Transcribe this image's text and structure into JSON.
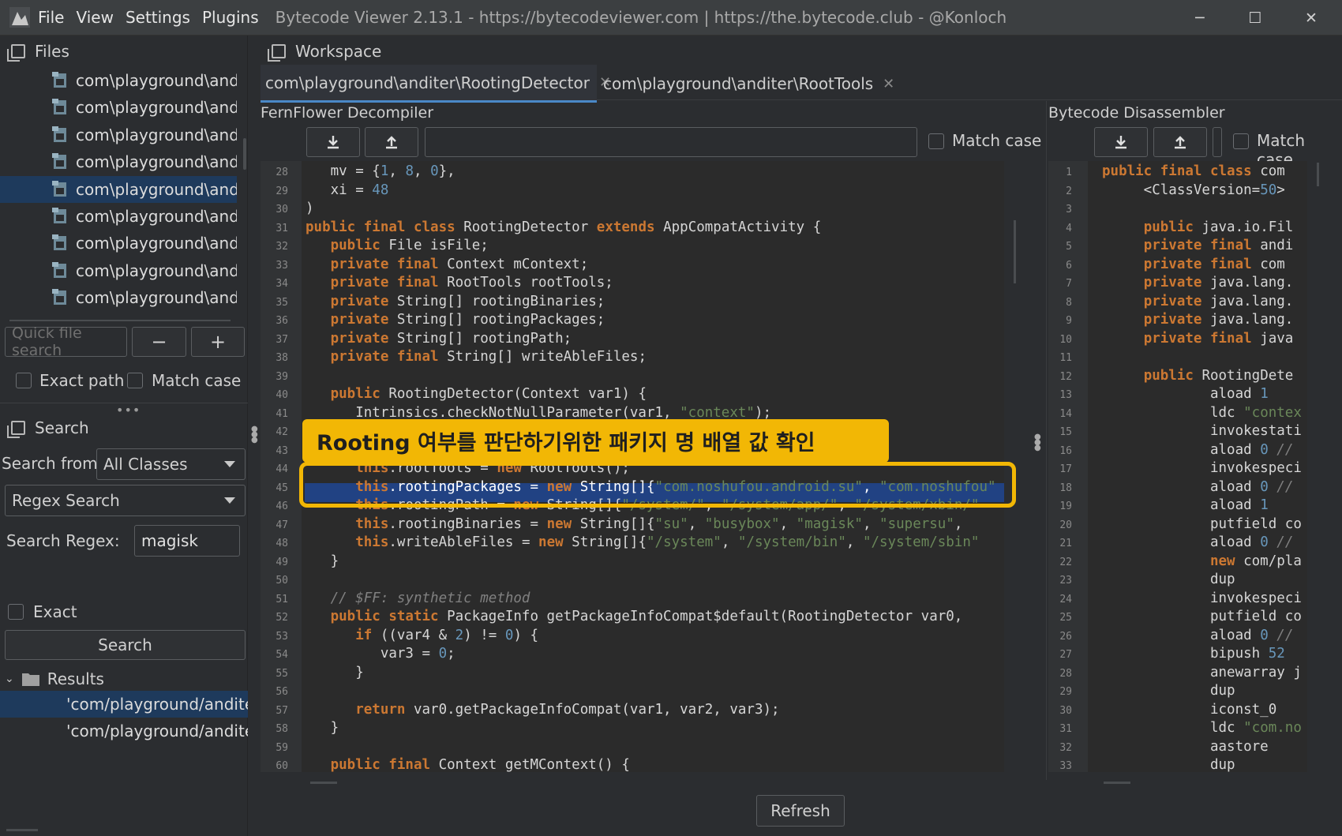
{
  "title_bar": {
    "menu": [
      "File",
      "View",
      "Settings",
      "Plugins"
    ],
    "title": "Bytecode Viewer 2.13.1 - https://bytecodeviewer.com | https://the.bytecode.club - @Konloch",
    "minimize": "─",
    "maximize": "☐",
    "close": "✕"
  },
  "files_panel": {
    "header": "Files",
    "items": [
      "com\\playground\\andi",
      "com\\playground\\andi",
      "com\\playground\\andi",
      "com\\playground\\andi",
      "com\\playground\\andi",
      "com\\playground\\andi",
      "com\\playground\\andi",
      "com\\playground\\andi",
      "com\\playground\\andi"
    ],
    "selected_index": 4,
    "quick_search_placeholder": "Quick file search",
    "minus": "−",
    "plus": "+",
    "exact_path": "Exact path",
    "match_case": "Match case"
  },
  "search_panel": {
    "header": "Search",
    "search_from_label": "Search from",
    "search_from_value": "All Classes",
    "mode_value": "Regex Search",
    "regex_label": "Search Regex:",
    "regex_value": "magisk",
    "exact": "Exact",
    "search_button": "Search",
    "results_label": "Results",
    "results": [
      "'com/playground/andite",
      "'com/playground/andite"
    ]
  },
  "workspace": {
    "header": "Workspace",
    "tabs": [
      {
        "label": "com\\playground\\anditer\\RootingDetector",
        "close": "✕",
        "active": true
      },
      {
        "label": "com\\playground\\anditer\\RootTools",
        "close": "✕",
        "active": false
      }
    ],
    "left_pane_title": "FernFlower Decompiler",
    "right_pane_title": "Bytecode Disassembler",
    "match_case": "Match case",
    "refresh": "Refresh"
  },
  "decompiler_lines": [
    {
      "n": "28",
      "html": "   mv = {<span class=\"n\">1</span>, <span class=\"n\">8</span>, <span class=\"n\">0</span>},"
    },
    {
      "n": "29",
      "html": "   xi = <span class=\"n\">48</span>"
    },
    {
      "n": "30",
      "html": ")"
    },
    {
      "n": "31",
      "html": "<span class=\"k\">public final class</span> RootingDetector <span class=\"k\">extends</span> AppCompatActivity {"
    },
    {
      "n": "32",
      "html": "   <span class=\"k\">public</span> File isFile;"
    },
    {
      "n": "33",
      "html": "   <span class=\"k\">private final</span> Context mContext;"
    },
    {
      "n": "34",
      "html": "   <span class=\"k\">private final</span> RootTools rootTools;"
    },
    {
      "n": "35",
      "html": "   <span class=\"k\">private</span> String[] rootingBinaries;"
    },
    {
      "n": "36",
      "html": "   <span class=\"k\">private</span> String[] rootingPackages;"
    },
    {
      "n": "37",
      "html": "   <span class=\"k\">private</span> String[] rootingPath;"
    },
    {
      "n": "38",
      "html": "   <span class=\"k\">private final</span> String[] writeAbleFiles;"
    },
    {
      "n": "39",
      "html": ""
    },
    {
      "n": "40",
      "html": "   <span class=\"k\">public</span> RootingDetector(Context var1) {"
    },
    {
      "n": "41",
      "html": "      Intrinsics.checkNotNullParameter(var1, <span class=\"s\">\"context\"</span>);"
    },
    {
      "n": "42",
      "html": ""
    },
    {
      "n": "43",
      "html": ""
    },
    {
      "n": "44",
      "html": "      <span class=\"k\">this</span>.rootTools = <span class=\"k\">new</span> RootTools();"
    },
    {
      "n": "45",
      "html": "      <span class=\"k\">this</span>.rootingPackages = <span class=\"k\">new</span> String[]{<span class=\"s\">\"com.noshufou.android.su\"</span>, <span class=\"s\">\"com.noshufou\"</span>"
    },
    {
      "n": "46",
      "html": "      <span class=\"k\">this</span>.rootingPath = <span class=\"k\">new</span> String[]{<span class=\"s\">\"/system/\"</span>, <span class=\"s\">\"/system/app/\"</span>, <span class=\"s\">\"/system/xbin/\"</span>"
    },
    {
      "n": "47",
      "html": "      <span class=\"k\">this</span>.rootingBinaries = <span class=\"k\">new</span> String[]{<span class=\"s\">\"su\"</span>, <span class=\"s\">\"busybox\"</span>, <span class=\"s\">\"magisk\"</span>, <span class=\"s\">\"supersu\"</span>,"
    },
    {
      "n": "48",
      "html": "      <span class=\"k\">this</span>.writeAbleFiles = <span class=\"k\">new</span> String[]{<span class=\"s\">\"/system\"</span>, <span class=\"s\">\"/system/bin\"</span>, <span class=\"s\">\"/system/sbin\"</span>"
    },
    {
      "n": "49",
      "html": "   }"
    },
    {
      "n": "50",
      "html": ""
    },
    {
      "n": "51",
      "html": "   <span class=\"c\">// $FF: synthetic method</span>"
    },
    {
      "n": "52",
      "html": "   <span class=\"k\">public static</span> PackageInfo getPackageInfoCompat$default(RootingDetector var0,"
    },
    {
      "n": "53",
      "html": "      <span class=\"k\">if</span> ((var4 &amp; <span class=\"n\">2</span>) != <span class=\"n\">0</span>) {"
    },
    {
      "n": "54",
      "html": "         var3 = <span class=\"n\">0</span>;"
    },
    {
      "n": "55",
      "html": "      }"
    },
    {
      "n": "56",
      "html": ""
    },
    {
      "n": "57",
      "html": "      <span class=\"k\">return</span> var0.getPackageInfoCompat(var1, var2, var3);"
    },
    {
      "n": "58",
      "html": "   }"
    },
    {
      "n": "59",
      "html": ""
    },
    {
      "n": "60",
      "html": "   <span class=\"k\">public final</span> Context getMContext() {"
    }
  ],
  "bytecode_lines": [
    {
      "n": "1",
      "html": "<span class=\"k\">public final class</span> com"
    },
    {
      "n": "2",
      "html": "     &lt;ClassVersion=<span class=\"n\">50</span>&gt;"
    },
    {
      "n": "3",
      "html": ""
    },
    {
      "n": "4",
      "html": "     <span class=\"k\">public</span> java.io.Fil"
    },
    {
      "n": "5",
      "html": "     <span class=\"k\">private final</span> andi"
    },
    {
      "n": "6",
      "html": "     <span class=\"k\">private final</span> com"
    },
    {
      "n": "7",
      "html": "     <span class=\"k\">private</span> java.lang."
    },
    {
      "n": "8",
      "html": "     <span class=\"k\">private</span> java.lang."
    },
    {
      "n": "9",
      "html": "     <span class=\"k\">private</span> java.lang."
    },
    {
      "n": "10",
      "html": "     <span class=\"k\">private final</span> java"
    },
    {
      "n": "11",
      "html": ""
    },
    {
      "n": "12",
      "html": "     <span class=\"k\">public</span> RootingDete"
    },
    {
      "n": "13",
      "html": "             aload <span class=\"n\">1</span>"
    },
    {
      "n": "14",
      "html": "             ldc <span class=\"s\">\"contex</span>"
    },
    {
      "n": "15",
      "html": "             invokestati"
    },
    {
      "n": "16",
      "html": "             aload <span class=\"n\">0</span> <span class=\"c\">//</span>"
    },
    {
      "n": "17",
      "html": "             invokespeci"
    },
    {
      "n": "18",
      "html": "             aload <span class=\"n\">0</span> <span class=\"c\">//</span>"
    },
    {
      "n": "19",
      "html": "             aload <span class=\"n\">1</span>"
    },
    {
      "n": "20",
      "html": "             putfield co"
    },
    {
      "n": "21",
      "html": "             aload <span class=\"n\">0</span> <span class=\"c\">//</span>"
    },
    {
      "n": "22",
      "html": "             <span class=\"k\">new</span> com/pla"
    },
    {
      "n": "23",
      "html": "             dup"
    },
    {
      "n": "24",
      "html": "             invokespeci"
    },
    {
      "n": "25",
      "html": "             putfield co"
    },
    {
      "n": "26",
      "html": "             aload <span class=\"n\">0</span> <span class=\"c\">//</span>"
    },
    {
      "n": "27",
      "html": "             bipush <span class=\"n\">52</span>"
    },
    {
      "n": "28",
      "html": "             anewarray j"
    },
    {
      "n": "29",
      "html": "             dup"
    },
    {
      "n": "30",
      "html": "             iconst_0"
    },
    {
      "n": "31",
      "html": "             ldc <span class=\"s\">\"com.no</span>"
    },
    {
      "n": "32",
      "html": "             aastore"
    },
    {
      "n": "33",
      "html": "             dup"
    }
  ],
  "callout": {
    "text": "Rooting 여부를 판단하기위한 패키지 명 배열 값 확인"
  },
  "colors": {
    "callout": "#f2b705",
    "selection": "#214283",
    "keyword": "#cc7832",
    "string": "#6a8759",
    "number": "#6897bb"
  }
}
